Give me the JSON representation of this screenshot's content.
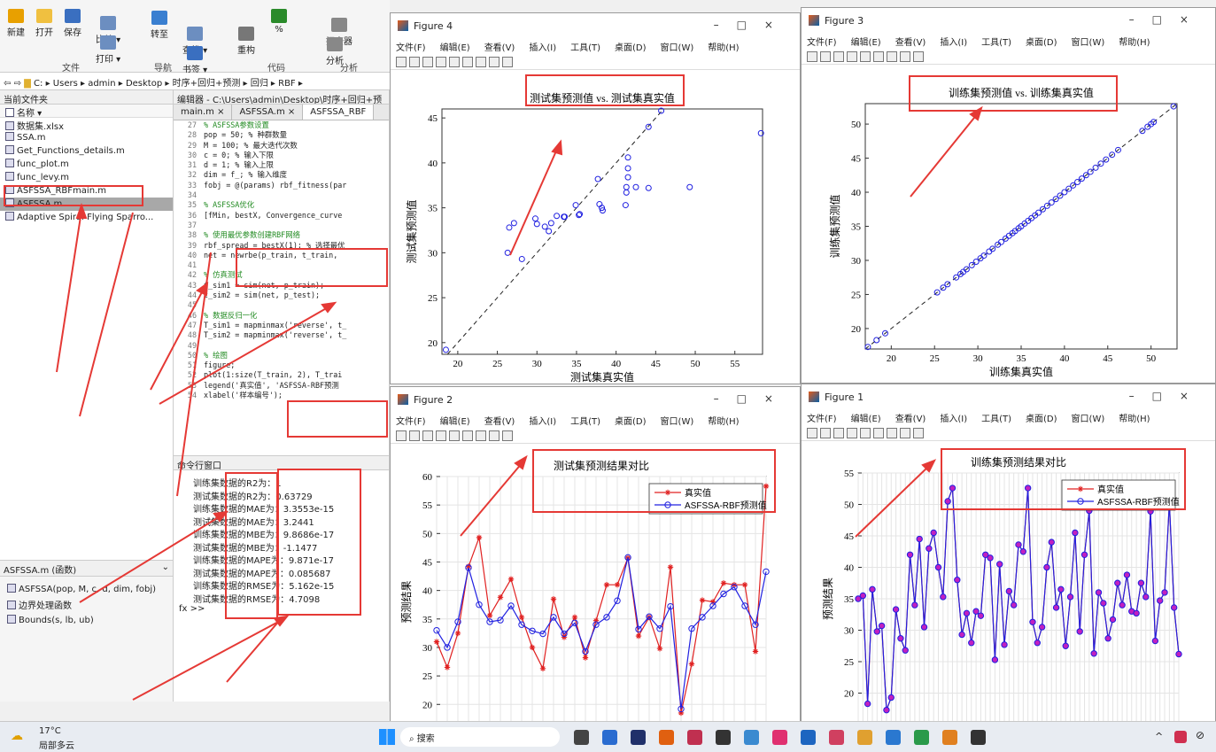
{
  "ribbon": {
    "buttons": [
      {
        "label": "新建",
        "color": "#e8a000"
      },
      {
        "label": "打开",
        "color": "#f0c040"
      },
      {
        "label": "保存",
        "color": "#3a6fc0"
      },
      {
        "label": "比较 ▾",
        "color": "#6c8ec0"
      },
      {
        "label": "打印 ▾",
        "color": "#6c8ec0"
      },
      {
        "label": "转至",
        "color": "#3a7fd0"
      },
      {
        "label": "查找 ▾",
        "color": "#6c8ec0"
      },
      {
        "label": "书签 ▾",
        "color": "#3a6fc0"
      },
      {
        "label": "重构",
        "color": "#777"
      },
      {
        "label": "%",
        "color": "#2a8a2a"
      },
      {
        "label": "探查器",
        "color": "#888"
      },
      {
        "label": "分析",
        "color": "#888"
      }
    ],
    "groups": [
      "文件",
      "导航",
      "代码",
      "分析"
    ]
  },
  "path": {
    "segments": [
      "C:",
      "Users",
      "admin",
      "Desktop",
      "时序+回归+预测",
      "回归",
      "RBF"
    ]
  },
  "file_panel": {
    "title": "当前文件夹",
    "column": "名称 ▾",
    "files": [
      {
        "name": "数据集.xlsx",
        "selected": false
      },
      {
        "name": "SSA.m",
        "selected": false
      },
      {
        "name": "Get_Functions_details.m",
        "selected": false
      },
      {
        "name": "func_plot.m",
        "selected": false
      },
      {
        "name": "func_levy.m",
        "selected": false
      },
      {
        "name": "ASFSSA_RBFmain.m",
        "selected": false
      },
      {
        "name": "ASFSSA.m",
        "selected": true
      },
      {
        "name": "Adaptive Spiral Flying Sparro...",
        "selected": false
      }
    ]
  },
  "detail_panel": {
    "title": "ASFSSA.m (函数)",
    "items": [
      "ASFSSA(pop, M, c, d, dim, fobj)",
      "边界处理函数",
      "Bounds(s, lb, ub)"
    ]
  },
  "editor": {
    "title": "编辑器 - C:\\Users\\admin\\Desktop\\时序+回归+预",
    "tabs": [
      "main.m",
      "ASFSSA.m",
      "ASFSSA_RBF"
    ],
    "lines": [
      {
        "n": "27",
        "code": "% ASFSSA参数设置",
        "kind": "comment"
      },
      {
        "n": "28",
        "code": "pop = 50; % 种群数量",
        "kind": "code"
      },
      {
        "n": "29",
        "code": "M = 100; % 最大迭代次数",
        "kind": "code"
      },
      {
        "n": "30",
        "code": "c = 0; % 输入下限",
        "kind": "code"
      },
      {
        "n": "31",
        "code": "d = 1; % 输入上限",
        "kind": "code"
      },
      {
        "n": "32",
        "code": "dim = f_; % 输入维度",
        "kind": "code"
      },
      {
        "n": "33",
        "code": "fobj = @(params) rbf_fitness(par",
        "kind": "code"
      },
      {
        "n": "34",
        "code": "",
        "kind": "code"
      },
      {
        "n": "35",
        "code": "% ASFSSA优化",
        "kind": "comment"
      },
      {
        "n": "36",
        "code": "[fMin, bestX, Convergence_curve",
        "kind": "code"
      },
      {
        "n": "37",
        "code": "",
        "kind": "code"
      },
      {
        "n": "38",
        "code": "% 使用最优参数创建RBF网络",
        "kind": "comment"
      },
      {
        "n": "39",
        "code": "rbf_spread = bestX(1); % 选择最优",
        "kind": "code"
      },
      {
        "n": "40",
        "code": "net = newrbe(p_train, t_train, ",
        "kind": "code"
      },
      {
        "n": "41",
        "code": "",
        "kind": "code"
      },
      {
        "n": "42",
        "code": "% 仿真测试",
        "kind": "comment"
      },
      {
        "n": "43",
        "code": "t_sim1 = sim(net, p_train);",
        "kind": "code"
      },
      {
        "n": "44",
        "code": "t_sim2 = sim(net, p_test);",
        "kind": "code"
      },
      {
        "n": "45",
        "code": "",
        "kind": "code"
      },
      {
        "n": "46",
        "code": "% 数据反归一化",
        "kind": "comment"
      },
      {
        "n": "47",
        "code": "T_sim1 = mapminmax('reverse', t_",
        "kind": "code"
      },
      {
        "n": "48",
        "code": "T_sim2 = mapminmax('reverse', t_",
        "kind": "code"
      },
      {
        "n": "49",
        "code": "",
        "kind": "code"
      },
      {
        "n": "50",
        "code": "% 绘图",
        "kind": "comment"
      },
      {
        "n": "51",
        "code": "figure;",
        "kind": "code"
      },
      {
        "n": "52",
        "code": "plot(1:size(T_train, 2), T_trai",
        "kind": "code"
      },
      {
        "n": "53",
        "code": "legend('真实值', 'ASFSSA-RBF预测",
        "kind": "code"
      },
      {
        "n": "54",
        "code": "xlabel('样本编号');",
        "kind": "code"
      }
    ]
  },
  "command_window": {
    "title": "命令行窗口",
    "lines": [
      "训练集数据的R2为：1",
      "测试集数据的R2为：0.63729",
      "训练集数据的MAE为：3.3553e-15",
      "测试集数据的MAE为：3.2441",
      "训练集数据的MBE为：9.8686e-17",
      "测试集数据的MBE为：-1.1477",
      "训练集数据的MAPE为：9.871e-17",
      "测试集数据的MAPE为：0.085687",
      "训练集数据的RMSE为：5.162e-15",
      "测试集数据的RMSE为：4.7098"
    ],
    "prompt": "fx >>"
  },
  "figure_menu": [
    "文件(F)",
    "编辑(E)",
    "查看(V)",
    "插入(I)",
    "工具(T)",
    "桌面(D)",
    "窗口(W)",
    "帮助(H)"
  ],
  "figures": {
    "fig4": {
      "title": "Figure 4"
    },
    "fig3": {
      "title": "Figure 3"
    },
    "fig2": {
      "title": "Figure 2"
    },
    "fig1": {
      "title": "Figure 1"
    }
  },
  "chart_data": [
    {
      "id": "fig4",
      "type": "scatter",
      "title": "测试集预测值 vs. 测试集真实值",
      "xlabel": "测试集真实值",
      "ylabel": "测试集预测值",
      "xlim": [
        18,
        58.5
      ],
      "ylim": [
        18.7,
        46
      ],
      "xticks": [
        20,
        25,
        30,
        35,
        40,
        45,
        50,
        55
      ],
      "yticks": [
        20,
        25,
        30,
        35,
        40,
        45
      ],
      "reference_line": "y=x",
      "points": [
        [
          18.5,
          19.2
        ],
        [
          26.3,
          30
        ],
        [
          26.5,
          32.8
        ],
        [
          27.1,
          33.3
        ],
        [
          28.1,
          29.3
        ],
        [
          29.8,
          33.8
        ],
        [
          30,
          33.2
        ],
        [
          31,
          32.9
        ],
        [
          31.5,
          32.4
        ],
        [
          31.8,
          33.3
        ],
        [
          32.5,
          34.1
        ],
        [
          33.4,
          34
        ],
        [
          33.5,
          34
        ],
        [
          34.9,
          35.3
        ],
        [
          35.3,
          34.2
        ],
        [
          35.4,
          34.3
        ],
        [
          37.7,
          38.2
        ],
        [
          37.9,
          35.4
        ],
        [
          38.2,
          35
        ],
        [
          38.3,
          34.7
        ],
        [
          41.2,
          35.3
        ],
        [
          41.3,
          36.7
        ],
        [
          41.3,
          37.3
        ],
        [
          41.5,
          38.4
        ],
        [
          41.5,
          39.4
        ],
        [
          41.5,
          40.6
        ],
        [
          42.5,
          37.3
        ],
        [
          44.1,
          37.2
        ],
        [
          44.1,
          44
        ],
        [
          45.7,
          45.8
        ],
        [
          49.3,
          37.3
        ],
        [
          58.3,
          43.3
        ]
      ],
      "color": "#2020e0"
    },
    {
      "id": "fig3",
      "type": "scatter",
      "title": "训练集预测值 vs. 训练集真实值",
      "xlabel": "训练集真实值",
      "ylabel": "训练集预测值",
      "xlim": [
        17,
        53
      ],
      "ylim": [
        17,
        53
      ],
      "xticks": [
        20,
        25,
        30,
        35,
        40,
        45,
        50
      ],
      "yticks": [
        20,
        25,
        30,
        35,
        40,
        45,
        50
      ],
      "reference_line": "y=x",
      "points": [
        [
          17.3,
          17.3
        ],
        [
          18.3,
          18.3
        ],
        [
          19.3,
          19.3
        ],
        [
          25.3,
          25.3
        ],
        [
          26,
          26
        ],
        [
          26.5,
          26.5
        ],
        [
          27.5,
          27.5
        ],
        [
          28,
          28
        ],
        [
          28.3,
          28.3
        ],
        [
          28.7,
          28.7
        ],
        [
          29.3,
          29.3
        ],
        [
          29.8,
          29.8
        ],
        [
          30.3,
          30.3
        ],
        [
          30.7,
          30.7
        ],
        [
          31.3,
          31.3
        ],
        [
          31.7,
          31.7
        ],
        [
          32.3,
          32.3
        ],
        [
          32.7,
          32.7
        ],
        [
          33.2,
          33.2
        ],
        [
          33.6,
          33.6
        ],
        [
          34,
          34
        ],
        [
          34.3,
          34.3
        ],
        [
          34.7,
          34.7
        ],
        [
          35,
          35
        ],
        [
          35.4,
          35.4
        ],
        [
          35.8,
          35.8
        ],
        [
          36.2,
          36.2
        ],
        [
          36.6,
          36.6
        ],
        [
          37,
          37
        ],
        [
          37.5,
          37.5
        ],
        [
          38,
          38
        ],
        [
          38.5,
          38.5
        ],
        [
          39,
          39
        ],
        [
          39.5,
          39.5
        ],
        [
          40,
          40
        ],
        [
          40.5,
          40.5
        ],
        [
          41,
          41
        ],
        [
          41.5,
          41.5
        ],
        [
          42,
          42
        ],
        [
          42.5,
          42.5
        ],
        [
          43,
          43
        ],
        [
          43.6,
          43.6
        ],
        [
          44.2,
          44.2
        ],
        [
          44.8,
          44.8
        ],
        [
          45.5,
          45.5
        ],
        [
          46.2,
          46.2
        ],
        [
          49,
          49
        ],
        [
          49.6,
          49.6
        ],
        [
          50,
          50
        ],
        [
          50.3,
          50.3
        ],
        [
          52.6,
          52.6
        ]
      ],
      "color": "#2020e0"
    },
    {
      "id": "fig2",
      "type": "line",
      "title": "测试集预测结果对比",
      "ylabel": "预测结果",
      "ylim": [
        16,
        60
      ],
      "yticks": [
        20,
        25,
        30,
        35,
        40,
        45,
        50,
        55,
        60
      ],
      "legend_position": "top-right",
      "series": [
        {
          "name": "真实值",
          "color": "#e02020",
          "marker": "star",
          "values": [
            31,
            26.5,
            32.5,
            44.2,
            49.3,
            35.6,
            38.8,
            42,
            35.3,
            30,
            26.3,
            38.5,
            31.8,
            35.3,
            28.2,
            34.7,
            41,
            41,
            45.7,
            32,
            35.3,
            29.8,
            44.1,
            18.5,
            27.1,
            38.3,
            38,
            41.3,
            41,
            41,
            29.3,
            58.3
          ]
        },
        {
          "name": "ASFSSA-RBF预测值",
          "color": "#2020e0",
          "marker": "circle",
          "values": [
            33,
            30,
            34.5,
            44,
            37.5,
            34.5,
            34.8,
            37.3,
            34,
            32.9,
            32.4,
            35.3,
            32.4,
            34.3,
            29.3,
            34,
            35.3,
            38.2,
            45.8,
            33.2,
            35.4,
            33.3,
            37.2,
            19.2,
            33.3,
            35.3,
            37.3,
            39.4,
            40.6,
            37.3,
            34,
            43.3
          ]
        }
      ]
    },
    {
      "id": "fig1",
      "type": "line",
      "title": "训练集预测结果对比",
      "ylabel": "预测结果",
      "ylim": [
        15,
        55
      ],
      "yticks": [
        15,
        20,
        25,
        30,
        35,
        40,
        45,
        50,
        55
      ],
      "legend_position": "top-right",
      "series": [
        {
          "name": "真实值",
          "color": "#e02020",
          "marker": "star",
          "values": [
            35,
            35.5,
            18.3,
            36.5,
            29.8,
            30.7,
            17.3,
            19.3,
            33.3,
            28.7,
            26.8,
            42,
            34,
            44.5,
            30.5,
            43,
            45.5,
            40,
            35.3,
            50.5,
            52.6,
            38,
            29.3,
            32.7,
            28,
            33,
            32.3,
            42,
            41.5,
            25.3,
            40.5,
            27.7,
            36.2,
            34,
            43.6,
            42.5,
            52.6,
            31.3,
            28,
            30.5,
            40,
            44,
            33.6,
            36.5,
            27.5,
            35.3,
            45.5,
            29.8,
            42,
            49,
            26.3,
            36,
            34.3,
            28.7,
            31.7,
            37.5,
            34,
            38.8,
            33,
            32.7,
            37.5,
            35.3,
            48.9,
            28.3,
            34.7,
            36,
            50.3,
            33.6,
            26.2
          ]
        },
        {
          "name": "ASFSSA-RBF预测值",
          "color": "#2020e0",
          "marker": "circle",
          "values": [
            35,
            35.5,
            18.3,
            36.5,
            29.8,
            30.7,
            17.3,
            19.3,
            33.3,
            28.7,
            26.8,
            42,
            34,
            44.5,
            30.5,
            43,
            45.5,
            40,
            35.3,
            50.5,
            52.6,
            38,
            29.3,
            32.7,
            28,
            33,
            32.3,
            42,
            41.5,
            25.3,
            40.5,
            27.7,
            36.2,
            34,
            43.6,
            42.5,
            52.6,
            31.3,
            28,
            30.5,
            40,
            44,
            33.6,
            36.5,
            27.5,
            35.3,
            45.5,
            29.8,
            42,
            49,
            26.3,
            36,
            34.3,
            28.7,
            31.7,
            37.5,
            34,
            38.8,
            33,
            32.7,
            37.5,
            35.3,
            48.9,
            28.3,
            34.7,
            36,
            50.3,
            33.6,
            26.2
          ]
        }
      ]
    }
  ],
  "taskbar": {
    "weather_temp": "17°C",
    "weather_desc": "局部多云",
    "search_label": "搜索",
    "app_colors": [
      "#444",
      "#2a6cd0",
      "#20306a",
      "#e06010",
      "#c03050",
      "#333",
      "#3a8ad0",
      "#e03070",
      "#1d65c0",
      "#d04060",
      "#e0a030",
      "#2a78d0",
      "#2a9a4a",
      "#e08020",
      "#333"
    ]
  }
}
